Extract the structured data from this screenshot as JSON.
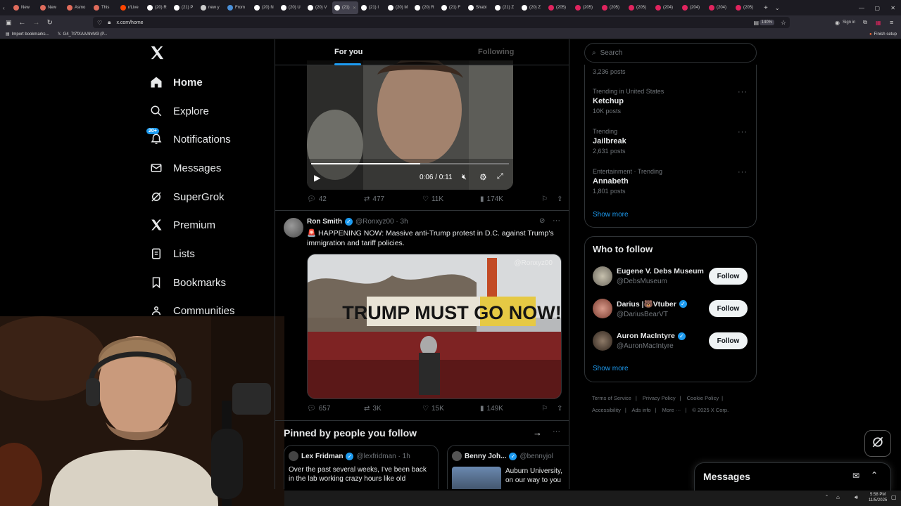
{
  "browser": {
    "tabs": [
      {
        "label": "New",
        "color": "#e06c5c"
      },
      {
        "label": "New",
        "color": "#e06c5c"
      },
      {
        "label": "Asmo",
        "color": "#e06c5c"
      },
      {
        "label": "This",
        "color": "#e06c5c"
      },
      {
        "label": "r/Live",
        "color": "#ff4500"
      },
      {
        "label": "(20) R",
        "color": "#ffffff"
      },
      {
        "label": "(21) P",
        "color": "#ffffff"
      },
      {
        "label": "new y",
        "color": "#cccccc"
      },
      {
        "label": "From",
        "color": "#4a90d9"
      },
      {
        "label": "(20) N",
        "color": "#ffffff"
      },
      {
        "label": "(20) U",
        "color": "#ffffff"
      },
      {
        "label": "(20) V",
        "color": "#ffffff"
      },
      {
        "label": "(21)",
        "color": "#ffffff"
      },
      {
        "label": "(21) I",
        "color": "#ffffff"
      },
      {
        "label": "(20) M",
        "color": "#ffffff"
      },
      {
        "label": "(20) R",
        "color": "#ffffff"
      },
      {
        "label": "(21) F",
        "color": "#ffffff"
      },
      {
        "label": "Shabi",
        "color": "#ffffff"
      },
      {
        "label": "(21) Z",
        "color": "#ffffff"
      },
      {
        "label": "(20) Z",
        "color": "#ffffff"
      },
      {
        "label": "(205)",
        "color": "#e0245e"
      },
      {
        "label": "(205)",
        "color": "#e0245e"
      },
      {
        "label": "(205)",
        "color": "#e0245e"
      },
      {
        "label": "(205)",
        "color": "#e0245e"
      },
      {
        "label": "(204)",
        "color": "#e0245e"
      },
      {
        "label": "(204)",
        "color": "#e0245e"
      },
      {
        "label": "(204)",
        "color": "#e0245e"
      },
      {
        "label": "(205)",
        "color": "#e0245e"
      }
    ],
    "url": "x.com/home",
    "zoom": "140%",
    "sign_in": "Sign in",
    "bookmarks": [
      "Import bookmarks...",
      "G4_7t7fXAAAhrM3 (P..."
    ],
    "finish_setup": "Finish setup"
  },
  "nav": {
    "home": "Home",
    "explore": "Explore",
    "notifications": "Notifications",
    "notifications_badge": "20+",
    "messages": "Messages",
    "supergrok": "SuperGrok",
    "premium": "Premium",
    "lists": "Lists",
    "bookmarks": "Bookmarks",
    "communities": "Communities"
  },
  "feed": {
    "tab_for_you": "For you",
    "tab_following": "Following",
    "video_time": "0:06 / 0:11",
    "video_progress": 0.55,
    "post1_stats": {
      "replies": "42",
      "reposts": "477",
      "likes": "11K",
      "views": "174K"
    },
    "post2": {
      "name": "Ron Smith",
      "handle": "@Ronxyz00 · 3h",
      "text": "🚨 HAPPENING NOW: Massive anti-Trump protest in D.C. against Trump's immigration and tariff policies.",
      "image_banner": "TRUMP MUST GO NOW!",
      "watermark": "@Ronxyz00",
      "stats": {
        "replies": "657",
        "reposts": "3K",
        "likes": "15K",
        "views": "149K"
      }
    },
    "pinned_title": "Pinned by people you follow",
    "pinned": [
      {
        "name": "Lex Fridman",
        "handle": "@lexfridman · 1h",
        "text": "Over the past several weeks, I've been back in the lab working crazy hours like old"
      },
      {
        "name": "Benny Joh...",
        "handle": "@bennyjol",
        "text": "Auburn University, on our way to you"
      }
    ]
  },
  "sidebar": {
    "search_placeholder": "Search",
    "trend_top_posts": "3,236 posts",
    "trends": [
      {
        "meta": "Trending in United States",
        "name": "Ketchup",
        "posts": "10K posts"
      },
      {
        "meta": "Trending",
        "name": "Jailbreak",
        "posts": "2,631 posts"
      },
      {
        "meta": "Entertainment · Trending",
        "name": "Annabeth",
        "posts": "1,801 posts"
      }
    ],
    "show_more": "Show more",
    "who_to_follow": "Who to follow",
    "follow_label": "Follow",
    "suggestions": [
      {
        "name": "Eugene V. Debs Museum",
        "handle": "@DebsMuseum",
        "verified": false
      },
      {
        "name": "Darius |🐻Vtuber",
        "handle": "@DariusBearVT",
        "verified": true
      },
      {
        "name": "Auron MacIntyre",
        "handle": "@AuronMacIntyre",
        "verified": true
      }
    ],
    "show_more_2": "Show more",
    "footer": [
      "Terms of Service",
      "Privacy Policy",
      "Cookie Policy",
      "Accessibility",
      "Ads info",
      "More ···",
      "© 2025 X Corp."
    ]
  },
  "messages_drawer": {
    "title": "Messages"
  },
  "taskbar": {
    "time": "5:58 PM",
    "date": "11/5/2025"
  }
}
